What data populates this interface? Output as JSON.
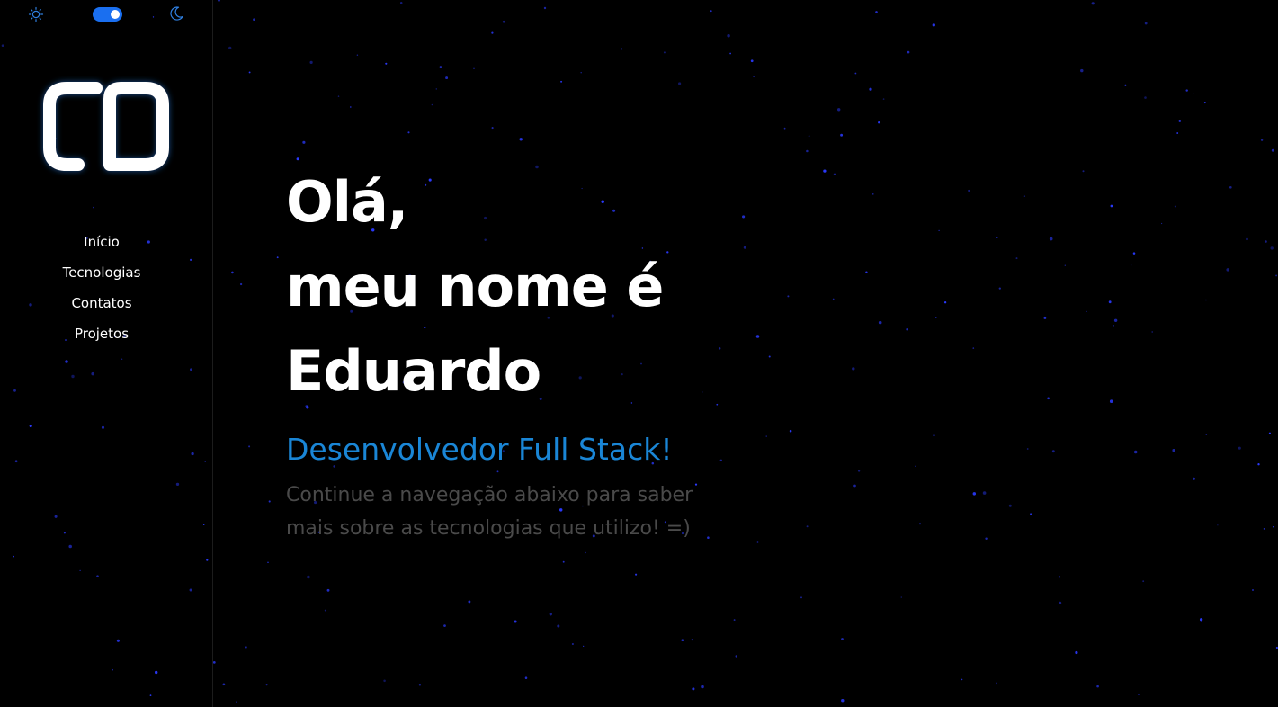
{
  "colors": {
    "background": "#000000",
    "accent": "#1a86d6",
    "toggle": "#1a6ff0",
    "star": "#2a3aff",
    "muted_text": "#4a4a4a"
  },
  "theme_switch": {
    "light_icon": "sun-icon",
    "dark_icon": "moon-icon",
    "state": "dark"
  },
  "logo": {
    "letters": "CD"
  },
  "nav": {
    "items": [
      {
        "label": "Início"
      },
      {
        "label": "Tecnologias"
      },
      {
        "label": "Contatos"
      },
      {
        "label": "Projetos"
      }
    ]
  },
  "hero": {
    "line1": "Olá,",
    "line2": "meu nome é",
    "line3": "Eduardo",
    "role": "Desenvolvedor Full Stack!",
    "intro": "Continue a navegação abaixo para saber mais sobre as tecnologias que utilizo! =)"
  }
}
